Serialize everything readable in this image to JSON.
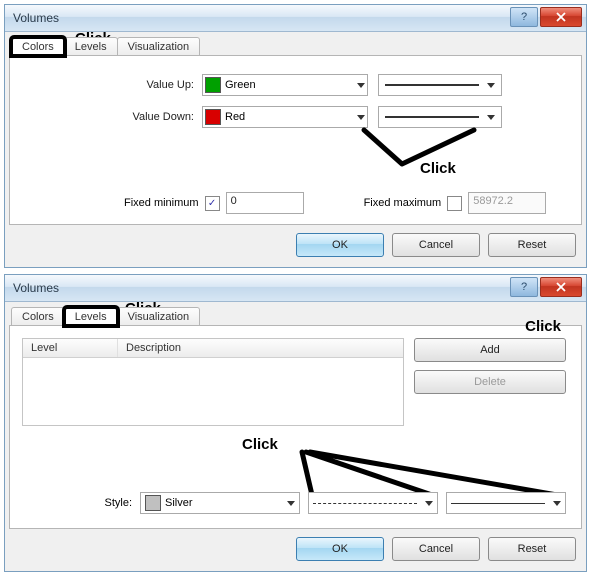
{
  "dialog1": {
    "title": "Volumes",
    "tabs": {
      "colors": "Colors",
      "levels": "Levels",
      "visualization": "Visualization"
    },
    "valueUpLabel": "Value Up:",
    "valueUpColor": "Green",
    "valueUpHex": "#00a000",
    "valueDownLabel": "Value Down:",
    "valueDownColor": "Red",
    "valueDownHex": "#d80000",
    "fixedMinLabel": "Fixed minimum",
    "fixedMinChecked": true,
    "fixedMinValue": "0",
    "fixedMaxLabel": "Fixed maximum",
    "fixedMaxChecked": false,
    "fixedMaxValue": "58972.2",
    "buttons": {
      "ok": "OK",
      "cancel": "Cancel",
      "reset": "Reset"
    },
    "annotation1": "Click",
    "annotation2": "Click"
  },
  "dialog2": {
    "title": "Volumes",
    "tabs": {
      "colors": "Colors",
      "levels": "Levels",
      "visualization": "Visualization"
    },
    "listHeaders": {
      "level": "Level",
      "description": "Description"
    },
    "addLabel": "Add",
    "deleteLabel": "Delete",
    "styleLabel": "Style:",
    "styleColor": "Silver",
    "styleColorHex": "#c0c0c0",
    "buttons": {
      "ok": "OK",
      "cancel": "Cancel",
      "reset": "Reset"
    },
    "annotation1": "Click",
    "annotation2": "Click",
    "annotation3": "Click"
  }
}
